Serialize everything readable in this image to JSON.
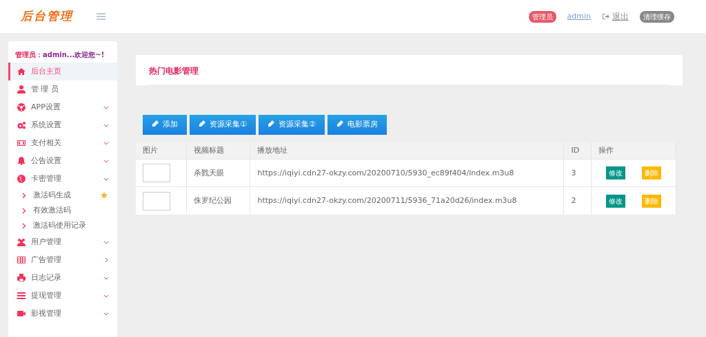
{
  "header": {
    "logo": "后台管理",
    "role_badge": "管理员",
    "username": "admin",
    "logout": "退出",
    "clear_cache": "清理缓存"
  },
  "sidebar": {
    "greeting_label": "管理员：",
    "greeting_text": "admin...欢迎您~!",
    "items": [
      {
        "label": "后台主页",
        "selected": true,
        "kind": "plain"
      },
      {
        "label": "管 理 员",
        "selected": false,
        "kind": "plain"
      },
      {
        "label": "APP设置",
        "selected": false,
        "kind": "dropdown"
      },
      {
        "label": "系统设置",
        "selected": false,
        "kind": "dropdown"
      },
      {
        "label": "支付相关",
        "selected": false,
        "kind": "dropdown"
      },
      {
        "label": "公告设置",
        "selected": false,
        "kind": "dropdown"
      },
      {
        "label": "卡密管理",
        "selected": false,
        "kind": "dropdown",
        "children": [
          {
            "label": "激活码生成",
            "starred": true
          },
          {
            "label": "有效激活码",
            "starred": false
          },
          {
            "label": "激活码使用记录",
            "starred": false
          }
        ]
      },
      {
        "label": "用户管理",
        "selected": false,
        "kind": "dropdown"
      },
      {
        "label": "广告管理",
        "selected": false,
        "kind": "link"
      },
      {
        "label": "日志记录",
        "selected": false,
        "kind": "dropdown"
      },
      {
        "label": "提现管理",
        "selected": false,
        "kind": "dropdown"
      },
      {
        "label": "影视管理",
        "selected": false,
        "kind": "dropdown"
      }
    ]
  },
  "page": {
    "title": "热门电影管理",
    "buttons": [
      "添加",
      "资源采集①",
      "资源采集②",
      "电影票房"
    ],
    "table": {
      "columns": [
        "图片",
        "视频标题",
        "播放地址",
        "ID",
        "操作"
      ],
      "rows": [
        {
          "title": "杀戮天眼",
          "url": "https://iqiyi.cdn27-okzy.com/20200710/5930_ec89f404/index.m3u8",
          "id": "3",
          "edit": "修改",
          "delete": "删除"
        },
        {
          "title": "侏罗纪公园",
          "url": "https://iqiyi.cdn27-okzy.com/20200711/5936_71a20d26/index.m3u8",
          "id": "2",
          "edit": "修改",
          "delete": "删除"
        }
      ]
    }
  }
}
